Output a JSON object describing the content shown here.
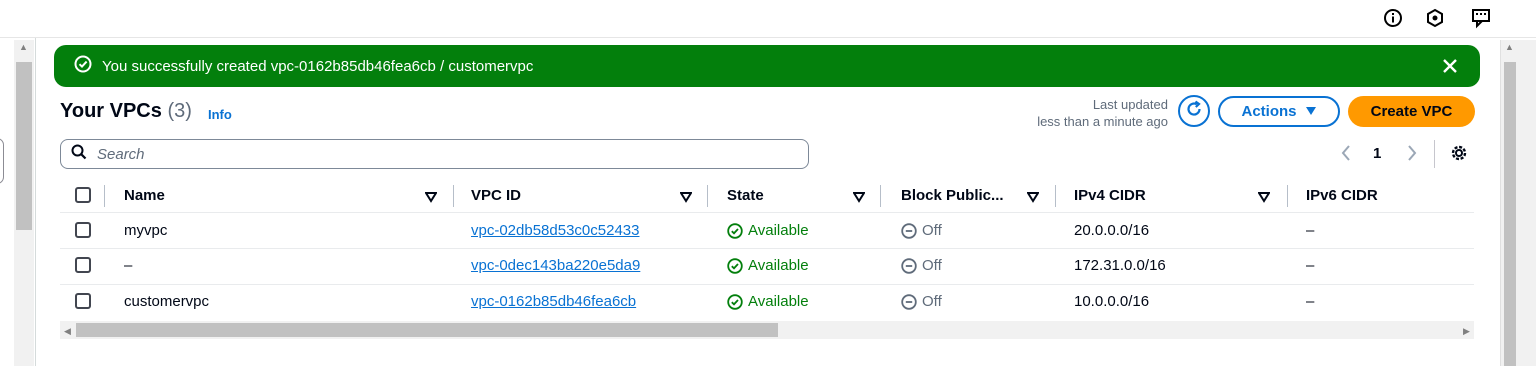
{
  "flash": {
    "message": "You successfully created vpc-0162b85db46fea6cb / customervpc",
    "color": "#037f0c"
  },
  "header": {
    "title": "Your VPCs",
    "count": "(3)",
    "info": "Info",
    "last_updated_label": "Last updated",
    "last_updated_value": "less than a minute ago"
  },
  "toolbar": {
    "actions_label": "Actions",
    "create_label": "Create VPC",
    "accent": "#0972d3",
    "primary": "#ff9900"
  },
  "search": {
    "placeholder": "Search"
  },
  "pagination": {
    "current_page": "1"
  },
  "table": {
    "columns": [
      "Name",
      "VPC ID",
      "State",
      "Block Public...",
      "IPv4 CIDR",
      "IPv6 CIDR"
    ],
    "rows": [
      {
        "name": "myvpc",
        "vpc_id": "vpc-02db58d53c0c52433",
        "state": "Available",
        "block_public": "Off",
        "ipv4": "20.0.0.0/16",
        "ipv6": "–"
      },
      {
        "name": "–",
        "vpc_id": "vpc-0dec143ba220e5da9",
        "state": "Available",
        "block_public": "Off",
        "ipv4": "172.31.0.0/16",
        "ipv6": "–"
      },
      {
        "name": "customervpc",
        "vpc_id": "vpc-0162b85db46fea6cb",
        "state": "Available",
        "block_public": "Off",
        "ipv4": "10.0.0.0/16",
        "ipv6": "–"
      }
    ]
  },
  "icons": [
    "info-icon",
    "hexagon-icon",
    "feedback-icon",
    "success-icon",
    "close-icon",
    "refresh-icon",
    "caret-down-icon",
    "search-icon",
    "chevron-left-icon",
    "chevron-right-icon",
    "gear-icon",
    "sort-icon",
    "status-available-icon",
    "status-off-icon"
  ]
}
